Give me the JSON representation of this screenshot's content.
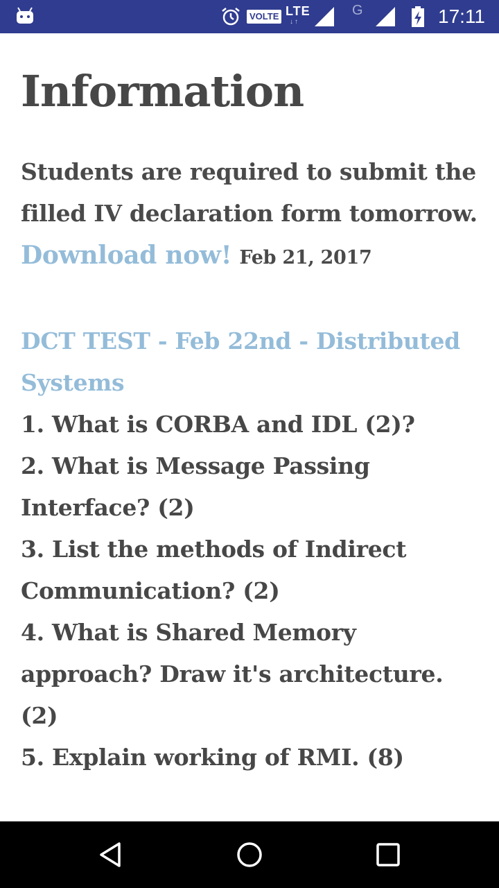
{
  "status_bar": {
    "volte": "VOLTE",
    "lte": "LTE",
    "lte_arrows": "↓↑",
    "network_g": "G",
    "time": "17:11",
    "icons": [
      "android-icon",
      "alarm-icon",
      "signal-icon",
      "signal-icon",
      "battery-charging-icon"
    ]
  },
  "page": {
    "title": "Information",
    "notice": {
      "text": "Students are required to submit the filled IV declaration form tomorrow.",
      "link": "Download now!",
      "date": "Feb 21, 2017"
    },
    "section": {
      "title": "DCT TEST - Feb 22nd - Distributed Systems",
      "questions": [
        "1. What is CORBA and IDL (2)?",
        "2. What is Message Passing Interface? (2)",
        "3. List the methods of Indirect Communication? (2)",
        "4. What is Shared Memory approach? Draw it's architecture. (2)",
        "5. Explain working of RMI. (8)"
      ]
    }
  },
  "nav_bar": {
    "icons": [
      "back-icon",
      "home-icon",
      "recents-icon"
    ]
  },
  "colors": {
    "status_bar": "#2f3c8f",
    "text": "#474747",
    "link": "#94bcd9",
    "nav_bar": "#000000"
  }
}
